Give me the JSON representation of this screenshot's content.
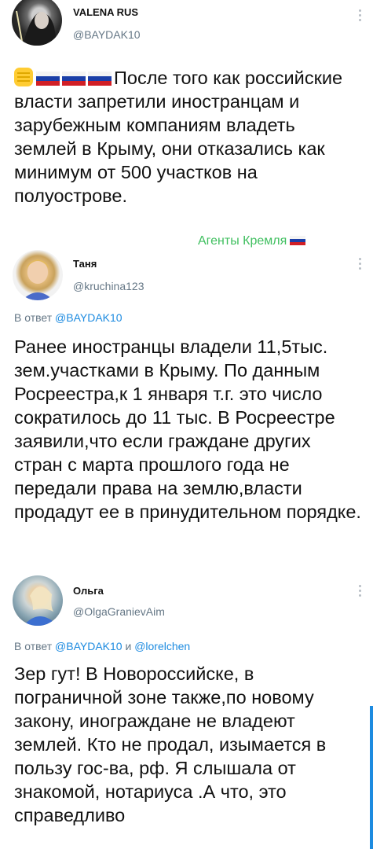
{
  "tweet1": {
    "name": "VALENA RUS",
    "handle": "@BAYDAK10",
    "text": "После того как российские власти запретили иностранцам и зарубежным компаниям владеть землей в Крыму, они отказались как минимум от 500 участков на полуострове.",
    "leading_icons": [
      "raised-fist-emoji",
      "russia-flag",
      "russia-flag",
      "russia-flag"
    ]
  },
  "watermark": {
    "text": "Агенты Кремля",
    "color": "#3fbf5f"
  },
  "tweet2": {
    "name": "Таня",
    "handle": "@kruchina123",
    "reply_prefix": "В ответ",
    "reply_to": "@BAYDAK10",
    "text": "Ранее иностранцы владели 11,5тыс. зем.участками в Крыму. По данным Росреестра,к 1 января т.г. это число сократилось до 11 тыс. В Росреестре заявили,что если граждане других стран с марта прошлого года не передали права на землю,власти продадут ее в принудительном порядке."
  },
  "tweet3": {
    "name": "Ольга",
    "handle": "@OlgaGranievAim",
    "reply_prefix": "В ответ",
    "reply_to": "@BAYDAK10",
    "reply_and": "и",
    "reply_to2": "@lorelchen",
    "text": "Зер гут! В Новороссийске, в пограничной зоне также,по новому закону, инограждане не владеют землей. Кто не продал, изымается в пользу гос-ва, рф. Я слышала от знакомой, нотариуса .А что, это справедливо"
  },
  "colors": {
    "link": "#1d8be0",
    "secondary": "#657786",
    "flag_white": "#f4f4f4",
    "flag_blue": "#1b3fa8",
    "flag_red": "#d11f26"
  }
}
